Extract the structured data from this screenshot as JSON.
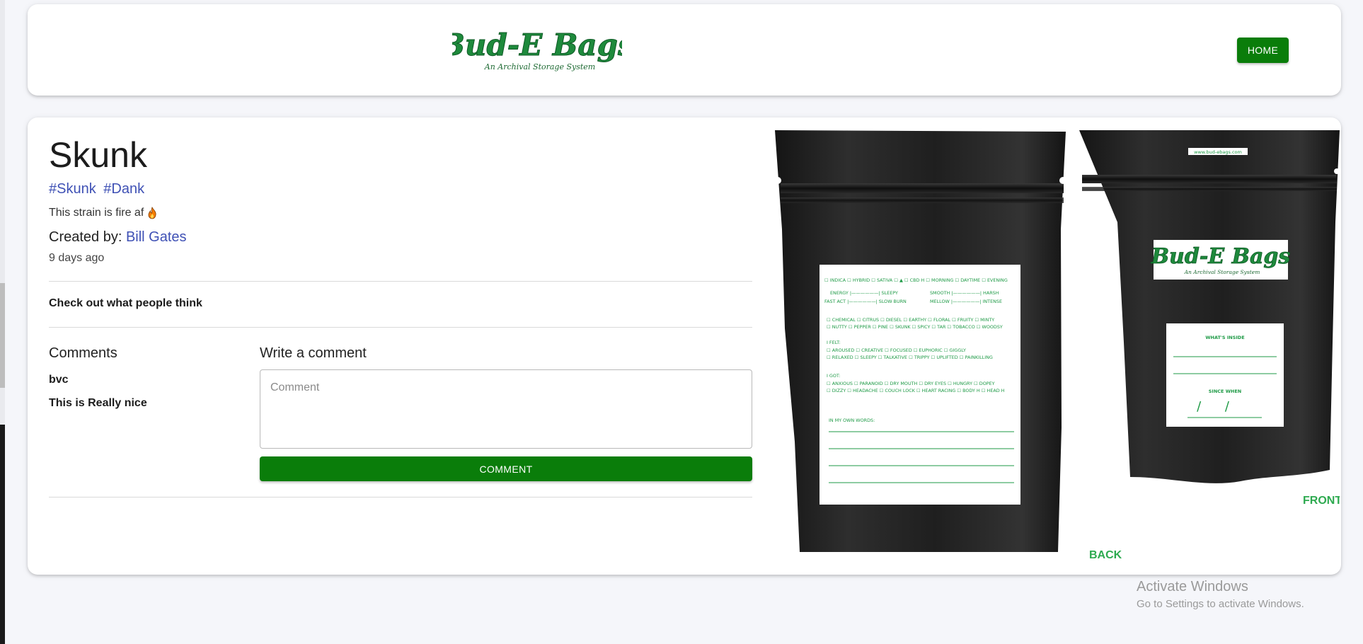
{
  "header": {
    "logo_text": "Bud-E Bags",
    "logo_tagline": "An Archival Storage System",
    "home_label": "HOME"
  },
  "post": {
    "title": "Skunk",
    "tags": [
      "#Skunk",
      "#Dank"
    ],
    "description": "This strain is fire af",
    "created_by_label": "Created by:",
    "author": "Bill Gates",
    "time_ago": "9 days ago",
    "section_label": "Check out what people think"
  },
  "comments": {
    "heading": "Comments",
    "items": [
      {
        "user": "bvc",
        "text": "This is Really nice"
      }
    ]
  },
  "write_comment": {
    "heading": "Write a comment",
    "placeholder": "Comment",
    "submit_label": "COMMENT"
  },
  "bag_image": {
    "url_text": "www.bud-ebags.com",
    "back_label": "BACK",
    "front_label": "FRONT",
    "back_card": {
      "row1": "☐ INDICA ☐ HYBRID ☐ SATIVA ☐ ▲ ☐ CBD H ☐ MORNING ☐ DAYTIME ☐ EVENING",
      "energy": "ENERGY |——————| SLEEPY",
      "fast": "FAST ACT |——————| SLOW BURN",
      "smooth": "SMOOTH |——————| HARSH",
      "mellow": "MELLOW |——————| INTENSE",
      "flavors1": "☐ CHEMICAL ☐ CITRUS ☐ DIESEL ☐ EARTHY ☐ FLORAL ☐ FRUITY ☐ MINTY",
      "flavors2": "☐ NUTTY ☐ PEPPER ☐ PINE ☐ SKUNK ☐ SPICY ☐ TAR ☐ TOBACCO ☐ WOODSY",
      "felt_label": "I FELT:",
      "felt1": "☐ AROUSED ☐ CREATIVE ☐ FOCUSED ☐ EUPHORIC ☐ GIGGLY",
      "felt2": "☐ RELAXED ☐ SLEEPY ☐ TALKATIVE ☐ TRIPPY ☐ UPLIFTED ☐ PAINKILLING",
      "got_label": "I GOT:",
      "got1": "☐ ANXIOUS ☐ PARANOID ☐ DRY MOUTH ☐ DRY EYES ☐ HUNGRY ☐ DOPEY",
      "got2": "☐ DIZZY ☐ HEADACHE ☐ COUCH LOCK ☐ HEART RACING ☐ BODY H ☐ HEAD H",
      "words_label": "IN MY OWN WORDS:"
    },
    "front_card": {
      "inside_label": "WHAT'S INSIDE",
      "since_label": "SINCE WHEN",
      "date_marks": "/ /"
    }
  },
  "watermark": {
    "title": "Activate Windows",
    "subtitle": "Go to Settings to activate Windows."
  },
  "colors": {
    "brand_green": "#0a7d0a",
    "logo_green": "#1e8a3c",
    "link_blue": "#3f51b5",
    "page_bg": "#f5f6fa"
  }
}
